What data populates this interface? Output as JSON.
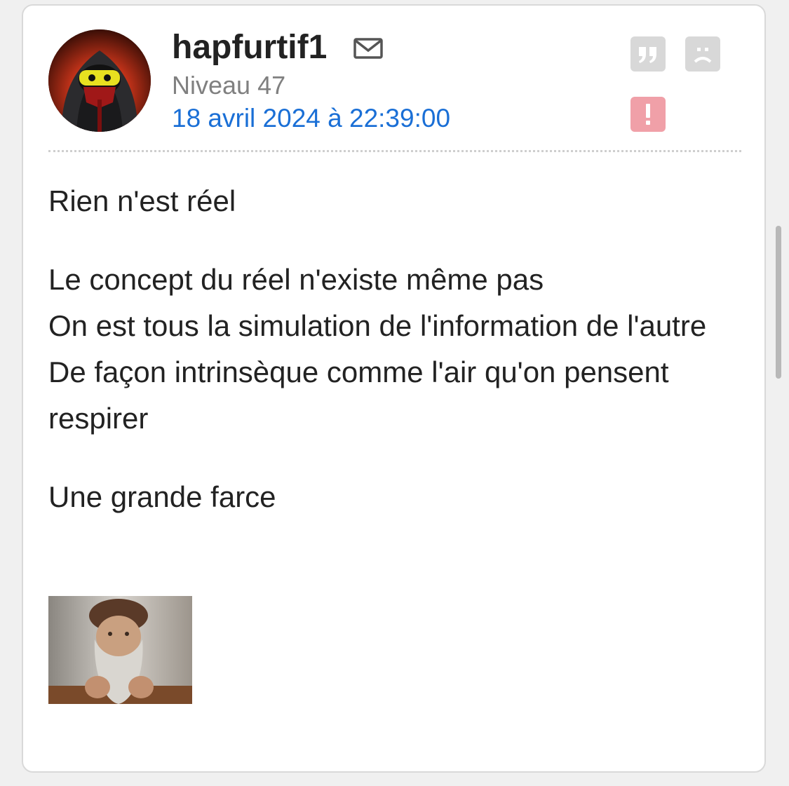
{
  "post": {
    "author": {
      "username": "hapfurtif1",
      "level": "Niveau 47",
      "avatar": "avatar-image"
    },
    "date": "18 avril 2024 à 22:39:00",
    "actions": {
      "mail": "mail-icon",
      "quote": "quote-icon",
      "sad": "sad-face-icon",
      "report": "alert-icon"
    },
    "body": {
      "lines": [
        "Rien n'est réel",
        "Le concept du réel n'existe même pas",
        "On est tous la simulation de l'information de l'autre",
        "De façon intrinsèque comme l'air qu'on pensent respirer",
        "Une grande farce"
      ]
    },
    "image": "bearded-man-sticker"
  },
  "colors": {
    "username": "#222222",
    "level": "#808080",
    "date": "#1a6fd6",
    "action_button": "#d8d8d8",
    "report_button": "#f0a0a8"
  }
}
